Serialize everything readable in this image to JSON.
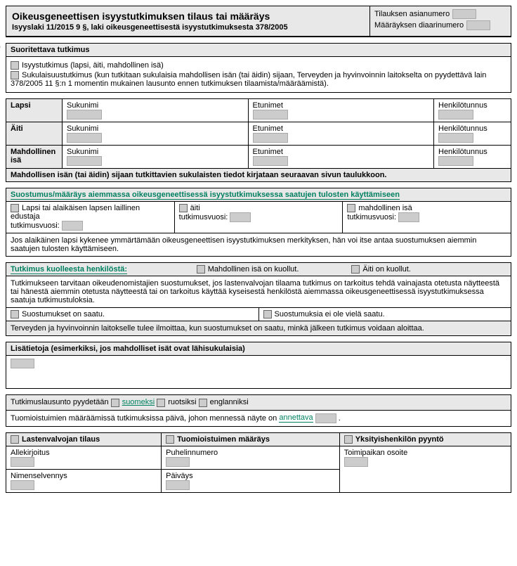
{
  "header": {
    "title": "Oikeusgeneettisen isyystutkimuksen tilaus tai määräys",
    "subtitle": "Isyyslaki 11/2015 9 §, laki oikeusgeneettisestä isyystutkimuksesta 378/2005",
    "field1": "Tilauksen asianumero",
    "field2": "Määräyksen diaarinumero"
  },
  "sec_suor": {
    "title": "Suoritettava tutkimus",
    "opt1": "Isyystutkimus (lapsi, äiti, mahdollinen isä)",
    "opt2": "Sukulaisuustutkimus (kun tutkitaan sukulaisia mahdollisen isän (tai äidin) sijaan, Terveyden ja hyvinvoinnin laitokselta on pyydettävä lain 378/2005 11 §:n 1 momentin mukainen lausunto ennen tutkimuksen tilaamista/määräämistä)."
  },
  "people": {
    "lapsi": "Lapsi",
    "aiti": "Äiti",
    "isa": "Mahdollinen isä",
    "sukunimi": "Sukunimi",
    "etunimet": "Etunimet",
    "hetu": "Henkilötunnus",
    "footer": "Mahdollisen isän (tai äidin) sijaan tutkittavien sukulaisten tiedot kirjataan seuraavan sivun taulukkoon."
  },
  "suostumus": {
    "title": "Suostumus/määräys aiemmassa oikeusgeneettisessä isyystutkimuksessa saatujen tulosten käyttämiseen",
    "opt_lapsi": "Lapsi tai alaikäisen lapsen laillinen edustaja",
    "opt_aiti": "äiti",
    "opt_isa": "mahdollinen isä",
    "tv": "tutkimusvuosi:",
    "note": "Jos alaikäinen lapsi kykenee ymmärtämään oikeusgeneettisen isyystutkimuksen merkityksen, hän voi itse antaa suostumuksen aiemmin saatujen tulosten käyttämiseen."
  },
  "kuollut": {
    "title": "Tutkimus kuolleesta henkilöstä:",
    "opt_isa": "Mahdollinen isä on kuollut.",
    "opt_aiti": "Äiti on kuollut.",
    "body": "Tutkimukseen tarvitaan oikeudenomistajien suostumukset, jos lastenvalvojan tilaama tutkimus on tarkoitus tehdä vainajasta otetusta näytteestä tai hänestä aiemmin otetusta näytteestä tai on tarkoitus käyttää kyseisestä henkilöstä aiemmassa oikeusgeneettisessä isyystutkimuksessa saatuja tutkimustuloksia.",
    "s1": "Suostumukset on saatu.",
    "s2": "Suostumuksia ei ole vielä saatu.",
    "note": "Terveyden ja hyvinvoinnin laitokselle tulee ilmoittaa, kun suostumukset on saatu, minkä jälkeen tutkimus voidaan aloittaa."
  },
  "lisatieto": {
    "title": "Lisätietoja (esimerkiksi, jos mahdolliset isät ovat lähisukulaisia)"
  },
  "lang": {
    "pre": "Tutkimuslausunto pyydetään",
    "fi": "suomeksi",
    "sv": "ruotsiksi",
    "en": "englanniksi",
    "deadline_pre": "Tuomioistuimien määräämissä tutkimuksissa päivä, johon mennessä näyte on",
    "deadline_u": "annettava"
  },
  "sig": {
    "h1": "Lastenvalvojan tilaus",
    "h2": "Tuomioistuimen määräys",
    "h3": "Yksityishenkilön pyyntö",
    "allek": "Allekirjoitus",
    "puh": "Puhelinnumero",
    "osoite": "Toimipaikan osoite",
    "nimen": "Nimenselvennys",
    "paiv": "Päiväys"
  }
}
